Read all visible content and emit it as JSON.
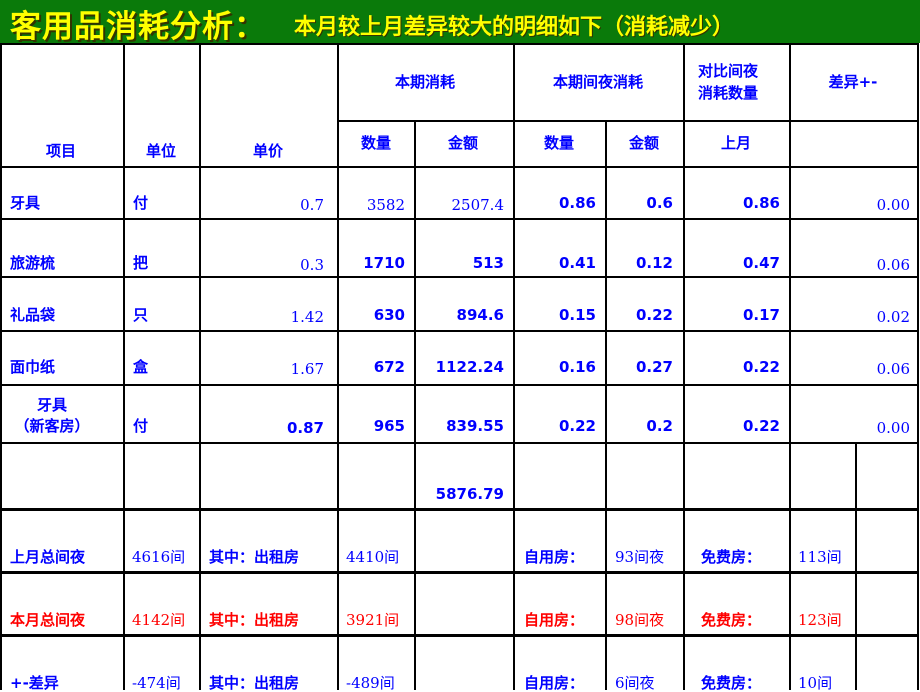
{
  "title": {
    "main": "客用品消耗分析：",
    "sub": "本月较上月差异较大的明细如下（消耗减少）"
  },
  "header": {
    "item": "项目",
    "unit": "单位",
    "price": "单价",
    "current_consumption": "本期消耗",
    "current_per_night": "本期间夜消耗",
    "compare_line1": "对比间夜",
    "compare_line2": "消耗数量",
    "diff": "差异+-",
    "qty": "数量",
    "amount": "金额",
    "qty2": "数量",
    "amount2": "金额",
    "last_month": "上月"
  },
  "rows": [
    {
      "item": "牙具",
      "unit": "付",
      "price": "0.7",
      "qty": "3582",
      "amount": "2507.4",
      "pn_qty": "0.86",
      "pn_amount": "0.6",
      "last": "0.86",
      "diff": "0.00"
    },
    {
      "item": "旅游梳",
      "unit": "把",
      "price": "0.3",
      "qty": "1710",
      "amount": "513",
      "pn_qty": "0.41",
      "pn_amount": "0.12",
      "last": "0.47",
      "diff": "0.06"
    },
    {
      "item": "礼品袋",
      "unit": "只",
      "price": "1.42",
      "qty": "630",
      "amount": "894.6",
      "pn_qty": "0.15",
      "pn_amount": "0.22",
      "last": "0.17",
      "diff": "0.02"
    },
    {
      "item": "面巾纸",
      "unit": "盒",
      "price": "1.67",
      "qty": "672",
      "amount": "1122.24",
      "pn_qty": "0.16",
      "pn_amount": "0.27",
      "last": "0.22",
      "diff": "0.06"
    },
    {
      "item_line1": "牙具",
      "item_line2": "（新客房）",
      "unit": "付",
      "price": "0.87",
      "qty": "965",
      "amount": "839.55",
      "pn_qty": "0.22",
      "pn_amount": "0.2",
      "last": "0.22",
      "diff": "0.00"
    }
  ],
  "total_amount": "5876.79",
  "summary": [
    {
      "label": "上月总间夜",
      "total": "4616间",
      "of_which": "其中：出租房",
      "rented": "4410间",
      "self_label": "自用房：",
      "self": "93间夜",
      "free_label": "免费房：",
      "free": "113间",
      "color": "#0000ff"
    },
    {
      "label": "本月总间夜",
      "total": "4142间",
      "of_which": "其中：出租房",
      "rented": "3921间",
      "self_label": "自用房：",
      "self": "98间夜",
      "free_label": "免费房：",
      "free": "123间",
      "color": "#ff0000"
    },
    {
      "label": "+-差异",
      "total": "-474间",
      "of_which": "其中：出租房",
      "rented": "-489间",
      "self_label": "自用房：",
      "self": "6间夜",
      "free_label": "免费房：",
      "free": "10间",
      "color": "#0000ff"
    }
  ],
  "colors": {
    "title_bg": "#0a7a0a",
    "title_text": "#ffff00",
    "text_blue": "#0000ff",
    "text_red": "#ff0000"
  }
}
